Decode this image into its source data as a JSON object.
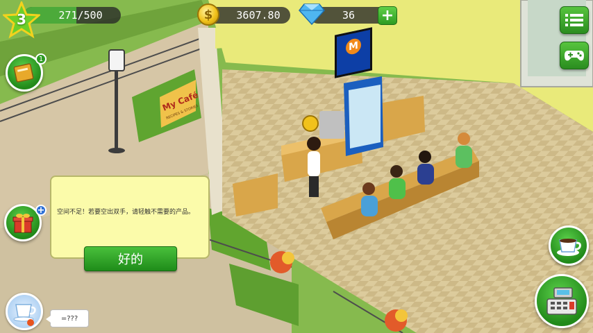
{
  "hud": {
    "level": "3",
    "xp_current": 271,
    "xp_max": 500,
    "xp_text": "271/500",
    "coins": "3607.80",
    "gems": "36",
    "add_gems_label": "+",
    "coin_icon_glyph": "$"
  },
  "buttons": {
    "quests_badge": "1",
    "gift_badge": "+"
  },
  "dialog": {
    "message": "空间不足！若要空出双手，请轻触不需要的产品。",
    "ok_label": "好的"
  },
  "chat": {
    "bubble_text": "=???"
  },
  "scene_text": {
    "signboard_brand": "My Café",
    "signboard_sub": "RECIPES & STORIES",
    "tv_logo_letter": "M"
  },
  "colors": {
    "accent_green": "#2d9b22",
    "dialog_bg": "#fbfbaa",
    "wall_yellow": "#e9ea7a",
    "floor_tile": "#d9c89a"
  },
  "icons": {
    "level": "star-icon",
    "coins": "coin-icon",
    "gems": "diamond-icon",
    "menu": "hamburger-menu-icon",
    "games": "gamepad-icon",
    "quests": "book-icon",
    "gifts": "gift-icon",
    "coffee": "coffee-cup-icon",
    "register": "cash-register-icon",
    "avatar": "teacup-icon"
  }
}
